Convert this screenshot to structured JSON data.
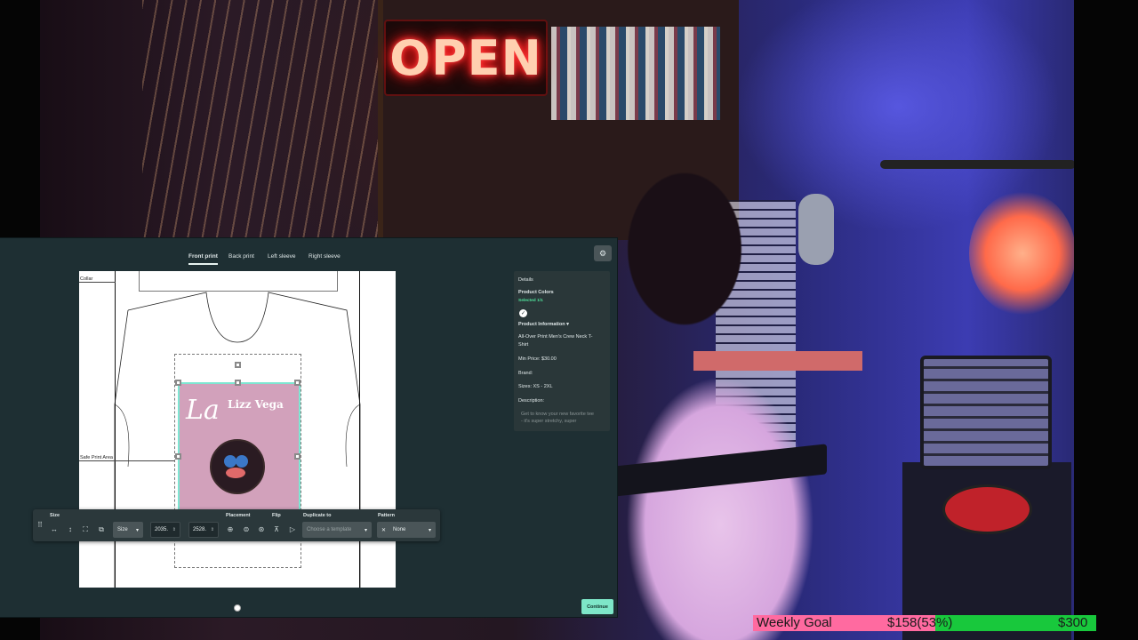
{
  "editor": {
    "tabs": [
      {
        "label": "Front print",
        "active": true
      },
      {
        "label": "Back print",
        "active": false
      },
      {
        "label": "Left sleeve",
        "active": false
      },
      {
        "label": "Right sleeve",
        "active": false
      }
    ],
    "canvas": {
      "collar_label": "Collar",
      "safe_area_label": "Safe Print Area",
      "artwork": {
        "la_text": "La",
        "name_text": "Lizz Vega"
      }
    },
    "toolbar": {
      "size_label": "Size",
      "size_select": "Size",
      "width_value": "2035.",
      "height_value": "2528.",
      "placement_label": "Placement",
      "flip_label": "Flip",
      "duplicate_label": "Duplicate to",
      "duplicate_placeholder": "Choose a template",
      "pattern_label": "Pattern",
      "pattern_value": "None"
    },
    "details": {
      "title": "Details",
      "product_colors": "Product Colors",
      "selected": "Selected 1/1",
      "product_information": "Product Information",
      "product_name": "All-Over Print Men's Crew Neck T-",
      "product_name_2": "Shirt",
      "min_price": "Min Price: $30.00",
      "brand": "Brand:",
      "sizes": "Sizes: XS - 2XL",
      "description": "Description:",
      "description_text": "Get to know your new favorite tee",
      "description_text_2": "- it's super stretchy, super"
    },
    "continue_label": "Continue"
  },
  "stream_overlay": {
    "open_sign": "OPEN",
    "weekly_goal": {
      "label": "Weekly Goal",
      "current": "$158(53%)",
      "target": "$300",
      "progress": 0.53,
      "fill_color": "#ff6aa0",
      "bar_color": "#18c83c"
    }
  },
  "colors": {
    "panel": "#1e2f33",
    "accent": "#7ee6c8",
    "artwork_bg": "#d2a1bb"
  }
}
